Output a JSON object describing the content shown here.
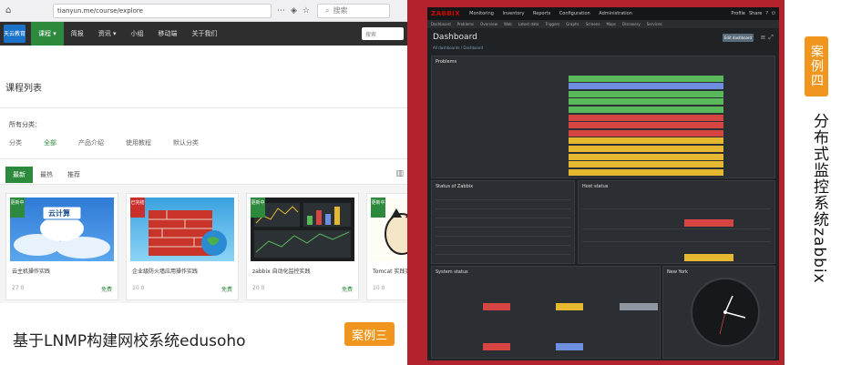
{
  "left_panel": {
    "browser": {
      "url": "tianyun.me/course/explore",
      "search_placeholder": "搜索"
    },
    "navbar": {
      "logo_text": "天云教育",
      "items": [
        "课程 ▾",
        "简报",
        "资讯 ▾",
        "小组",
        "移动端",
        "关于我们"
      ],
      "search_placeholder": "搜索"
    },
    "page_title": "课程列表",
    "category_label": "所有分类：",
    "categories": [
      "分类",
      "全部",
      "产品介绍",
      "使用教程",
      "默认分类"
    ],
    "sort_tabs": [
      "最新",
      "最热",
      "推荐"
    ],
    "cards": [
      {
        "badge": "更新中",
        "title": "云主机操作实践",
        "meta": "27  0",
        "price": "免费",
        "thumb_label": "云计算"
      },
      {
        "badge": "已完结",
        "title": "企业级防火墙应用操作实践",
        "meta": "10  0",
        "price": "免费",
        "thumb_label": ""
      },
      {
        "badge": "更新中",
        "title": "zabbix 自动化监控实践",
        "meta": "20  0",
        "price": "免费",
        "thumb_label": ""
      },
      {
        "badge": "更新中",
        "title": "Tomcat 实践实践",
        "meta": "10  0",
        "price": "免费",
        "thumb_label": ""
      }
    ],
    "caption": "基于LNMP构建网校系统edusoho",
    "case_tag": "案例三"
  },
  "right_panel": {
    "logo": "ZABBIX",
    "menu": [
      "Monitoring",
      "Inventory",
      "Reports",
      "Configuration",
      "Administration"
    ],
    "user_links": [
      "Profile",
      "Share",
      "?",
      "⏻"
    ],
    "submenu": [
      "Dashboard",
      "Problems",
      "Overview",
      "Web",
      "Latest data",
      "Triggers",
      "Graphs",
      "Screens",
      "Maps",
      "Discovery",
      "Services"
    ],
    "dashboard_title": "Dashboard",
    "edit_button": "Edit dashboard",
    "breadcrumb": "All dashboards / Dashboard",
    "widgets": {
      "problems": "Problems",
      "status": "Status of Zabbix",
      "host_status": "Host status",
      "system_status": "System status",
      "clock": "New York"
    },
    "problem_rows": [
      "green",
      "blue",
      "green",
      "green",
      "green",
      "red",
      "red",
      "red",
      "yellow",
      "yellow",
      "yellow",
      "yellow",
      "yellow"
    ],
    "colors": {
      "green": "#58b85a",
      "blue": "#6e8ee0",
      "red": "#d64541",
      "yellow": "#e6b830"
    }
  },
  "right_caption": {
    "case_tag": "案例四",
    "caption": "分布式监控系统zabbix"
  }
}
